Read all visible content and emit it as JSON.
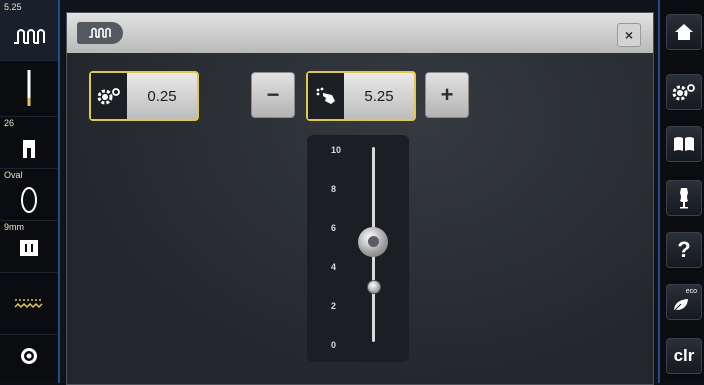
{
  "left_sidebar": {
    "stitch_number": "5.25",
    "presser_foot_number": "26",
    "hoop_label": "Oval",
    "plate_label": "9mm"
  },
  "window": {
    "close_label": "×"
  },
  "controls": {
    "stitch_length_value": "0.25",
    "minus_label": "−",
    "plus_label": "+",
    "current_value": "5.25"
  },
  "slider": {
    "tick_labels": [
      "10",
      "8",
      "6",
      "4",
      "2",
      "0"
    ],
    "current_level": 5.25,
    "default_level": 3.0,
    "range": [
      0,
      10
    ]
  },
  "right_sidebar": {
    "help_label": "?",
    "eco_label": "eco",
    "clear_label": "clr"
  },
  "colors": {
    "highlight_border": "#e0c84a",
    "sidebar_border": "#1d4d8a"
  }
}
